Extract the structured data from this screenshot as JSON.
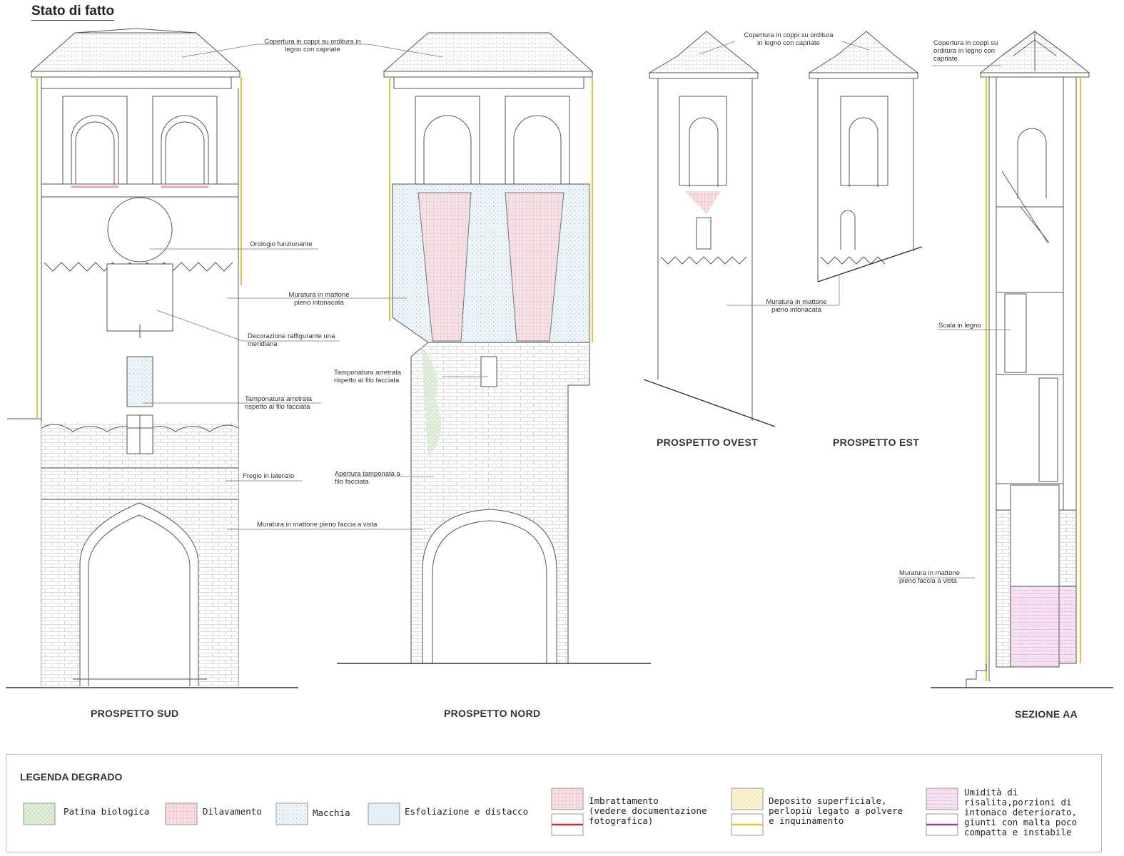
{
  "page_title": "Stato di fatto",
  "views": {
    "sud": "PROSPETTO SUD",
    "nord": "PROSPETTO NORD",
    "ovest": "PROSPETTO OVEST",
    "est": "PROSPETTO EST",
    "sezione": "SEZIONE AA"
  },
  "annotations": {
    "copertura_1": "Copertura in coppi su orditura in\nlegno con capriate",
    "copertura_2": "Copertura in coppi su orditura\nin legno con capriate",
    "copertura_3": "Copertura in coppi su\norditura in legno con\ncapriate",
    "orologio": "Orologio funzionante",
    "muratura_intonacata_1": "Muratura in mattone\npieno intonacata",
    "meridiana": "Decorazione raffigurante una\nmeridiana",
    "tamponatura_sud": "Tamponatura arretrata\nrispetto al filo facciata",
    "tamponatura_nord": "Tamponatura arretrata\nrispetto al filo facciata",
    "fregio": "Fregio in laterizio",
    "apertura": "Apertura tamponata a\nfilo facciata",
    "muratura_vista_1": "Muratura in mattone pieno faccia a vista",
    "muratura_intonacata_2": "Muratura in mattone\npieno intonacata",
    "scala": "Scala in legno",
    "muratura_vista_2": "Muratura in mattone\npieno faccia a vista"
  },
  "legend": {
    "title": "LEGENDA DEGRADO",
    "items": [
      {
        "label": "Patina biologica",
        "color": "#b8d9a8"
      },
      {
        "label": "Dilavamento",
        "color": "#f2c4cc"
      },
      {
        "label": "Macchia",
        "color": "#c9dde8"
      },
      {
        "label": "Esfoliazione e distacco",
        "color": "#d3e6ef"
      },
      {
        "label": "Imbrattamento\n(vedere documentazione\nfotografica)",
        "color": "#f0b8c0",
        "line_color": "#e0242c"
      },
      {
        "label": "Deposito superficiale,\nperlopiù legato a polvere\ne inquinamento",
        "color": "#f3e7a8",
        "line_color": "#f2c12e"
      },
      {
        "label": "Umidità di\nrisalita,porzioni di\nintonaco deteriorato,\ngiunti con malta poco\ncompatta e instabile",
        "color": "#e7c0e0",
        "line_color": "#9a3c9e"
      }
    ]
  }
}
